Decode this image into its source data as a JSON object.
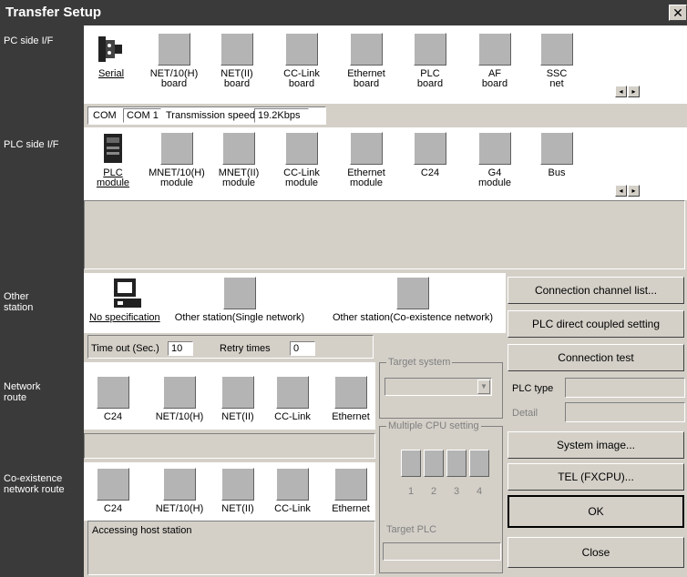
{
  "window": {
    "title": "Transfer Setup",
    "close": "✕"
  },
  "left": {
    "pc_side": "PC side I/F",
    "plc_side": "PLC side I/F",
    "other_station": "Other\nstation",
    "network_route": "Network\nroute",
    "coexistence": "Co-existence\nnetwork route"
  },
  "pc_icons": [
    {
      "label": "Serial",
      "icon": "serial-cable-icon"
    },
    {
      "label": "NET/10(H)\nboard"
    },
    {
      "label": "NET(II)\nboard"
    },
    {
      "label": "CC-Link\nboard"
    },
    {
      "label": "Ethernet\nboard"
    },
    {
      "label": "PLC\nboard"
    },
    {
      "label": "AF\nboard"
    },
    {
      "label": "SSC\nnet"
    }
  ],
  "com": {
    "label": "COM",
    "value": "COM 1",
    "speed_label": "Transmission speed",
    "speed_value": "19.2Kbps"
  },
  "plc_icons": [
    {
      "label": "PLC\nmodule",
      "icon": "plc-module-icon"
    },
    {
      "label": "MNET/10(H)\nmodule"
    },
    {
      "label": "MNET(II)\nmodule"
    },
    {
      "label": "CC-Link\nmodule"
    },
    {
      "label": "Ethernet\nmodule"
    },
    {
      "label": "C24"
    },
    {
      "label": "G4\nmodule"
    },
    {
      "label": "Bus"
    }
  ],
  "other_icons": [
    {
      "label": "No specification",
      "icon": "computer-icon"
    },
    {
      "label": "Other station(Single network)"
    },
    {
      "label": "Other station(Co-existence network)"
    }
  ],
  "timeout": {
    "label": "Time out (Sec.)",
    "value": "10",
    "retry_label": "Retry times",
    "retry_value": "0"
  },
  "network_icons": [
    "C24",
    "NET/10(H)",
    "NET(II)",
    "CC-Link",
    "Ethernet"
  ],
  "coexist_icons": [
    "C24",
    "NET/10(H)",
    "NET(II)",
    "CC-Link",
    "Ethernet"
  ],
  "status_text": "Accessing host station",
  "target_system": {
    "label": "Target system"
  },
  "multi_cpu": {
    "label": "Multiple CPU setting",
    "numbers": [
      "1",
      "2",
      "3",
      "4"
    ]
  },
  "target_plc": {
    "label": "Target PLC"
  },
  "plc_type": {
    "label": "PLC type",
    "detail_label": "Detail"
  },
  "buttons": {
    "connection_channel": "Connection channel list...",
    "plc_direct": "PLC direct coupled setting",
    "connection_test": "Connection test",
    "system_image": "System image...",
    "tel": "TEL (FXCPU)...",
    "ok": "OK",
    "close": "Close"
  },
  "scroll": {
    "left": "◂",
    "right": "▸"
  }
}
